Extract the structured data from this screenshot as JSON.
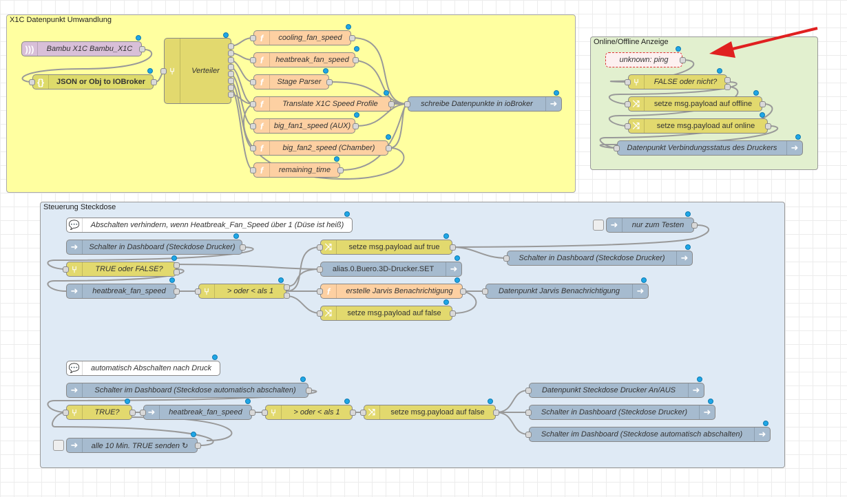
{
  "groups": {
    "g1": "X1C Datenpunkt Umwandlung",
    "g2": "Online/Offline Anzeige",
    "g3": "Steuerung Steckdose"
  },
  "nodes": {
    "mqtt": "Bambu X1C Bambu_X1C",
    "json": "JSON or Obj to IOBroker",
    "verteiler": "Verteiler",
    "f1": "cooling_fan_speed",
    "f2": "heatbreak_fan_speed",
    "f3": "Stage Parser",
    "f4": "Translate X1C Speed Profile",
    "f5": "big_fan1_speed (AUX)",
    "f6": "big_fan2_speed (Chamber)",
    "f7": "remaining_time",
    "schreibe": "schreibe Datenpunkte in ioBroker",
    "ping": "unknown: ping",
    "falseoder": "FALSE oder nicht?",
    "setoffline": "setze msg.payload auf offline",
    "setonline": "setze msg.payload auf online",
    "dpverb": "Datenpunkt Verbindungsstatus des Druckers",
    "cmt1": "Abschalten verhindern, wenn Heatbreak_Fan_Speed über 1 (Düse ist heiß)",
    "testen": "nur zum Testen",
    "schalter1": "Schalter in Dashboard (Steckdose Drucker)",
    "trueorfalse": "TRUE oder FALSE?",
    "hbfs1": "heatbreak_fan_speed",
    "oderals1": "> oder < als 1",
    "settrue": "setze msg.payload auf true",
    "alias": "alias.0.Buero.3D-Drucker.SET",
    "jarvisfn": "erstelle Jarvis Benachrichtigung",
    "setfalse1": "setze msg.payload auf false",
    "schalter2": "Schalter in Dashboard (Steckdose Drucker)",
    "jarvisdp": "Datenpunkt Jarvis Benachrichtigung",
    "cmt2": "automatisch Abschalten nach Druck",
    "schalterauto": "Schalter im Dashboard (Steckdose automatisch abschalten)",
    "truecheck": "TRUE?",
    "hbfs2": "heatbreak_fan_speed",
    "oderals2": "> oder < als 1",
    "setfalse2": "setze msg.payload auf false",
    "dpsteck": "Datenpunkt Steckdose Drucker An/AUS",
    "schalter3": "Schalter in Dashboard (Steckdose Drucker)",
    "schalterauto2": "Schalter im Dashboard (Steckdose automatisch abschalten)",
    "alle10": "alle 10 Min. TRUE senden ↻"
  },
  "icons": {
    "mqtt": "wifi-icon",
    "json": "json-icon",
    "switch": "switch-icon",
    "function": "function-icon",
    "change": "shuffle-icon",
    "iobroker": "arrow-right-icon",
    "comment": "comment-icon",
    "inject": "inject-icon"
  },
  "colors": {
    "function": "#fdd0a2",
    "switch": "#e2d96e",
    "iobroker": "#a6bbcf",
    "mqtt": "#d8bfd8",
    "group1_bg": "#ffffa0",
    "group2_bg": "#e2f0cf",
    "group3_bg": "#dfeaf5",
    "arrow": "#e02020",
    "status_dot": "#1fa6e6"
  }
}
